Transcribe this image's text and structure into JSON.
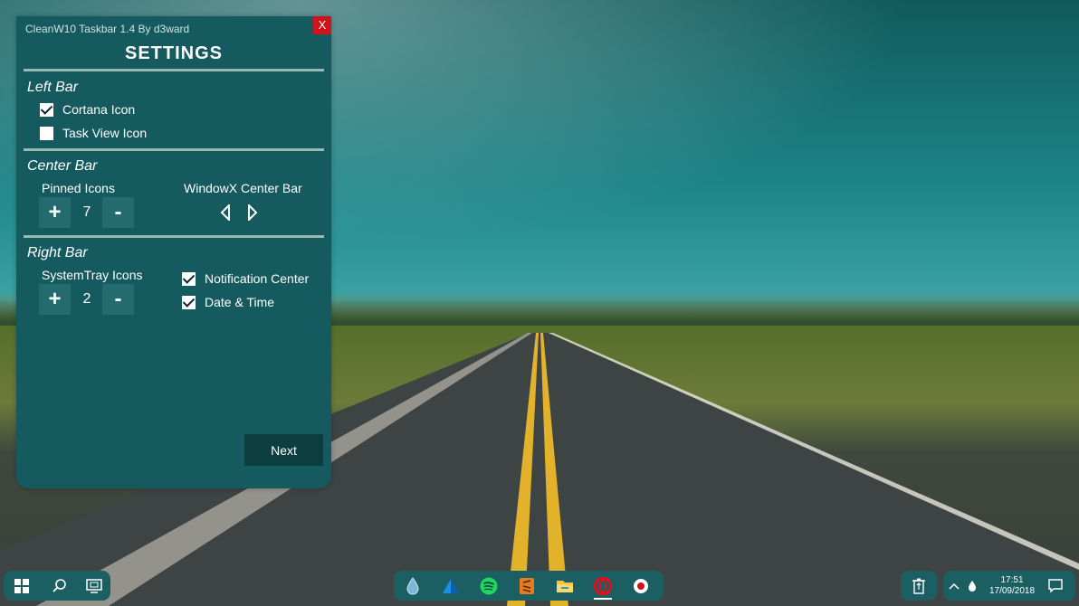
{
  "panel": {
    "title": "CleanW10 Taskbar 1.4 By d3ward",
    "close_label": "X",
    "heading": "SETTINGS",
    "left_bar": {
      "title": "Left Bar",
      "options": [
        {
          "label": "Cortana Icon",
          "checked": true
        },
        {
          "label": "Task View Icon",
          "checked": false
        }
      ]
    },
    "center_bar": {
      "title": "Center Bar",
      "pinned_label": "Pinned Icons",
      "pinned_value": "7",
      "plus_label": "+",
      "minus_label": "-",
      "windowx_label": "WindowX Center Bar"
    },
    "right_bar": {
      "title": "Right Bar",
      "systray_label": "SystemTray Icons",
      "systray_value": "2",
      "plus_label": "+",
      "minus_label": "-",
      "options": [
        {
          "label": "Notification Center",
          "checked": true
        },
        {
          "label": "Date & Time",
          "checked": true
        }
      ]
    },
    "next_label": "Next"
  },
  "taskbar": {
    "left_icons": [
      "windows-start-icon",
      "search-icon",
      "task-view-icon"
    ],
    "center_icons": [
      "droplet-app-icon",
      "triangle-app-icon",
      "spotify-icon",
      "sublime-text-icon",
      "file-explorer-icon",
      "opera-icon",
      "record-app-icon"
    ],
    "tray": {
      "time": "17:51",
      "date": "17/09/2018"
    }
  },
  "colors": {
    "panel_bg": "#155a5e",
    "close_red": "#d0121b",
    "taskbar_bg": "#1b5f62",
    "spotify_green": "#1ed760",
    "opera_red": "#e0101e",
    "sublime_orange": "#e97a1f"
  }
}
